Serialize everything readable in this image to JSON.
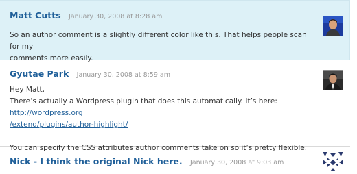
{
  "comments": [
    {
      "author": "Matt Cutts",
      "date": "January 30, 2008 at 8:28 am",
      "is_author_comment": true,
      "avatar_icon": "avatar-photo-icon",
      "paragraphs": [
        {
          "line1": "So an author comment is a slightly different color like this. That helps people scan for my",
          "line2": "comments more easily."
        }
      ]
    },
    {
      "author": "Gyutae Park",
      "date": "January 30, 2008 at 8:59 am",
      "is_author_comment": false,
      "avatar_icon": "avatar-photo-icon",
      "greeting": "Hey Matt,",
      "text_before_link": "There’s actually a Wordpress plugin that does this automatically. It’s here: ",
      "link_part1": "http://wordpress.org",
      "link_part2": "/extend/plugins/author-highlight/",
      "paragraph2": "You can specify the CSS attributes author comments take on so it’s pretty flexible."
    },
    {
      "author": "Nick - I think the original Nick here.",
      "date": "January 30, 2008 at 9:03 am",
      "is_author_comment": false,
      "avatar_icon": "identicon-avatar-icon"
    }
  ],
  "colors": {
    "author_background": "#ddf1f7",
    "name_link": "#1f5f99",
    "date_text": "#999999",
    "body_text": "#333333",
    "divider": "#d9d9d9"
  }
}
